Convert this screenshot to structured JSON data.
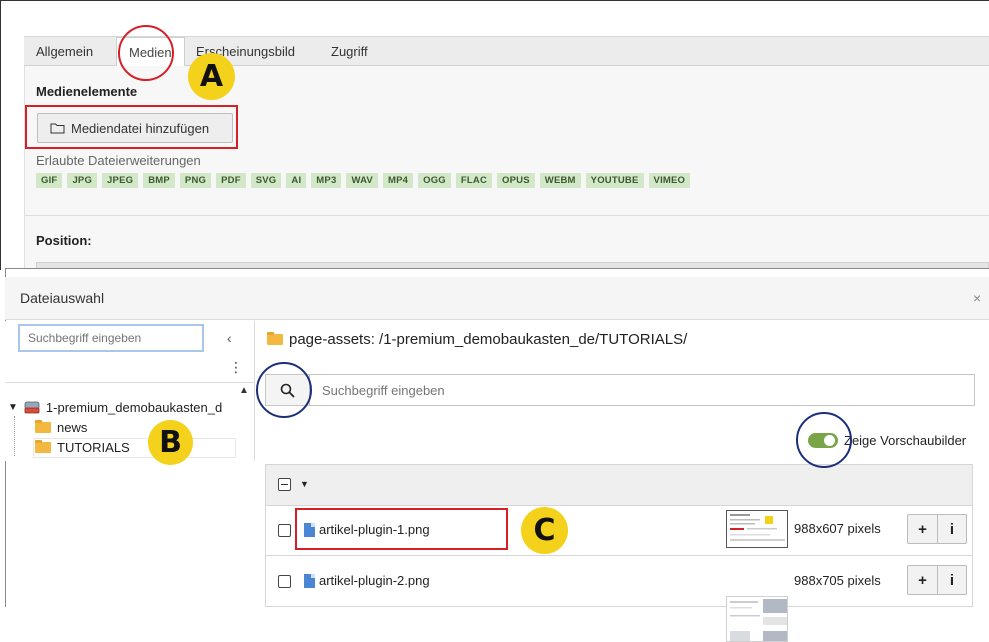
{
  "editor": {
    "tabs": [
      "Allgemein",
      "Medien",
      "Erscheinungsbild",
      "Zugriff"
    ],
    "active_tab": "Medien",
    "media_section_title": "Medienelemente",
    "add_media_button": "Mediendatei hinzufügen",
    "allowed_extensions_label": "Erlaubte Dateierweiterungen",
    "extensions": [
      "GIF",
      "JPG",
      "JPEG",
      "BMP",
      "PNG",
      "PDF",
      "SVG",
      "AI",
      "MP3",
      "WAV",
      "MP4",
      "OGG",
      "FLAC",
      "OPUS",
      "WEBM",
      "YOUTUBE",
      "VIMEO"
    ],
    "position_label": "Position:"
  },
  "annotations": {
    "badge_a": "A",
    "badge_b": "B",
    "badge_c": "C"
  },
  "dialog": {
    "title": "Dateiauswahl",
    "close_symbol": "×",
    "tree": {
      "search_placeholder": "Suchbegriff eingeben",
      "collapse_symbol": "‹",
      "menu_symbol": "⋮",
      "root": "1-premium_demobaukasten_d",
      "children": [
        "news",
        "TUTORIALS"
      ]
    },
    "path": "page-assets: /1-premium_demobaukasten_de/TUTORIALS/",
    "search_placeholder": "Suchbegriff eingeben",
    "thumbnail_toggle_label": "Zeige Vorschaubilder",
    "thumbnail_toggle_on": true,
    "files": [
      {
        "name": "artikel-plugin-1.png",
        "dimensions": "988x607 pixels"
      },
      {
        "name": "artikel-plugin-2.png",
        "dimensions": "988x705 pixels"
      }
    ],
    "row_actions": {
      "add": "+",
      "info": "i"
    }
  },
  "colors": {
    "annotation_red": "#d42027",
    "annotation_blue": "#1c2f7a",
    "badge_yellow": "#f4d11b",
    "extension_badge_bg": "#d3e8c8",
    "toggle_green": "#79a548",
    "folder_orange": "#f3b840"
  }
}
